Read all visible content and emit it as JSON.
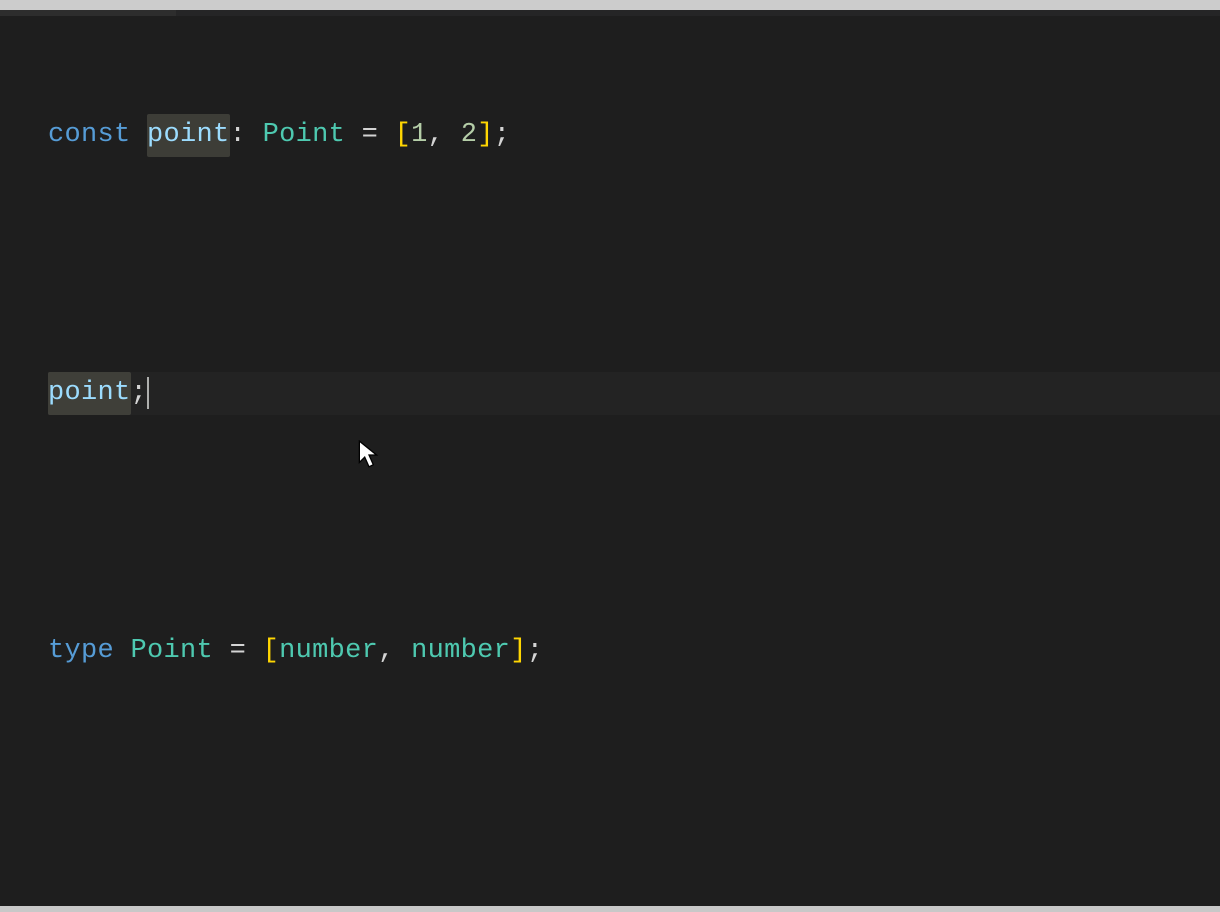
{
  "theme": {
    "background": "#1e1e1e",
    "foreground": "#d4d4d4",
    "keyword": "#569cd6",
    "variable": "#9cdcfe",
    "type": "#4ec9b0",
    "number": "#b5cea8",
    "bracket": "#ffd602"
  },
  "code": {
    "line1": {
      "kw": "const",
      "sp1": " ",
      "var": "point",
      "colon": ":",
      "sp2": " ",
      "type": "Point",
      "sp3": " ",
      "eq": "=",
      "sp4": " ",
      "lb": "[",
      "n1": "1",
      "comma": ",",
      "sp5": " ",
      "n2": "2",
      "rb": "]",
      "semi": ";"
    },
    "line2": "",
    "line3": {
      "var": "point",
      "semi": ";"
    },
    "line4": "",
    "line5": {
      "kw": "type",
      "sp1": " ",
      "name": "Point",
      "sp2": " ",
      "eq": "=",
      "sp3": " ",
      "lb": "[",
      "t1": "number",
      "comma": ",",
      "sp4": " ",
      "t2": "number",
      "rb": "]",
      "semi": ";"
    }
  }
}
